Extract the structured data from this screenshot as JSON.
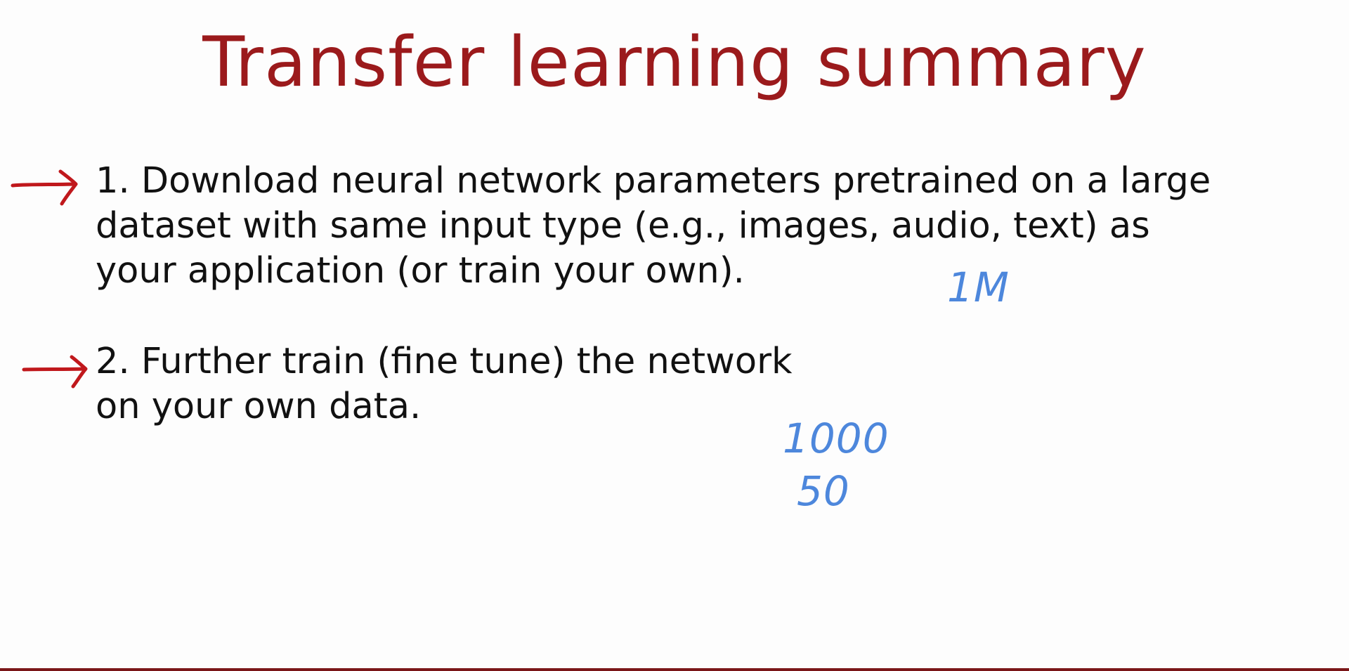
{
  "slide": {
    "title": "Transfer learning summary",
    "bullets": [
      {
        "text": "1. Download neural network parameters pretrained on a large\ndataset with same input type (e.g., images, audio, text) as\nyour application (or train your own)."
      },
      {
        "text": "2. Further train (fine tune) the network\non your own data."
      }
    ],
    "annotations": {
      "pretrain_size": "1M",
      "finetune_size_a": "1000",
      "finetune_size_b": "50"
    },
    "colors": {
      "title": "#9b1a1c",
      "arrows": "#c0181c",
      "handwriting": "#4d87dc",
      "bottom_bar": "#7a1618"
    }
  }
}
